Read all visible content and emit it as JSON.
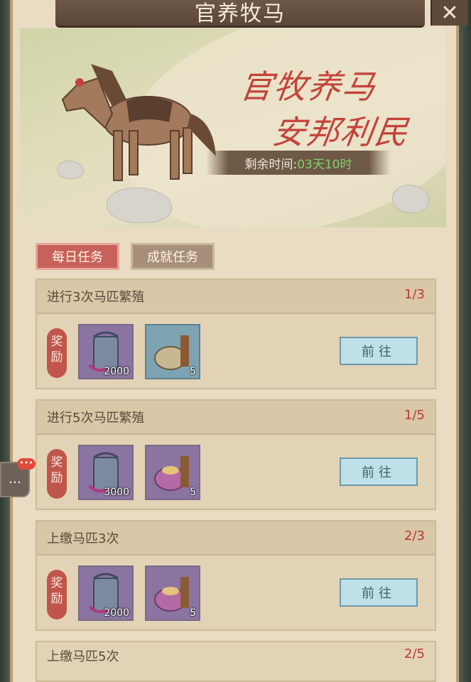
{
  "window": {
    "title": "官养牧马"
  },
  "banner": {
    "slogan_line1": "官牧养马",
    "slogan_line2": "安邦利民",
    "timer_label": "剩余时间:",
    "timer_value": "03天10时"
  },
  "tabs": [
    {
      "label": "每日任务",
      "active": true
    },
    {
      "label": "成就任务",
      "active": false
    }
  ],
  "reward_label": "奖励",
  "go_label": "前往",
  "tasks": [
    {
      "name": "进行3次马匹繁殖",
      "progress": "1/3",
      "items": [
        {
          "icon": "horse-token-icon",
          "qty": "2000"
        },
        {
          "icon": "feed-sack-blue-icon",
          "qty": "5"
        }
      ]
    },
    {
      "name": "进行5次马匹繁殖",
      "progress": "1/5",
      "items": [
        {
          "icon": "horse-token-icon",
          "qty": "3000"
        },
        {
          "icon": "feed-sack-purple-icon",
          "qty": "5"
        }
      ]
    },
    {
      "name": "上缴马匹3次",
      "progress": "2/3",
      "items": [
        {
          "icon": "horse-token-icon",
          "qty": "2000"
        },
        {
          "icon": "feed-sack-purple-icon",
          "qty": "5"
        }
      ]
    },
    {
      "name": "上缴马匹5次",
      "progress": "2/5",
      "items": []
    }
  ],
  "chat": {
    "badge": "•••"
  }
}
